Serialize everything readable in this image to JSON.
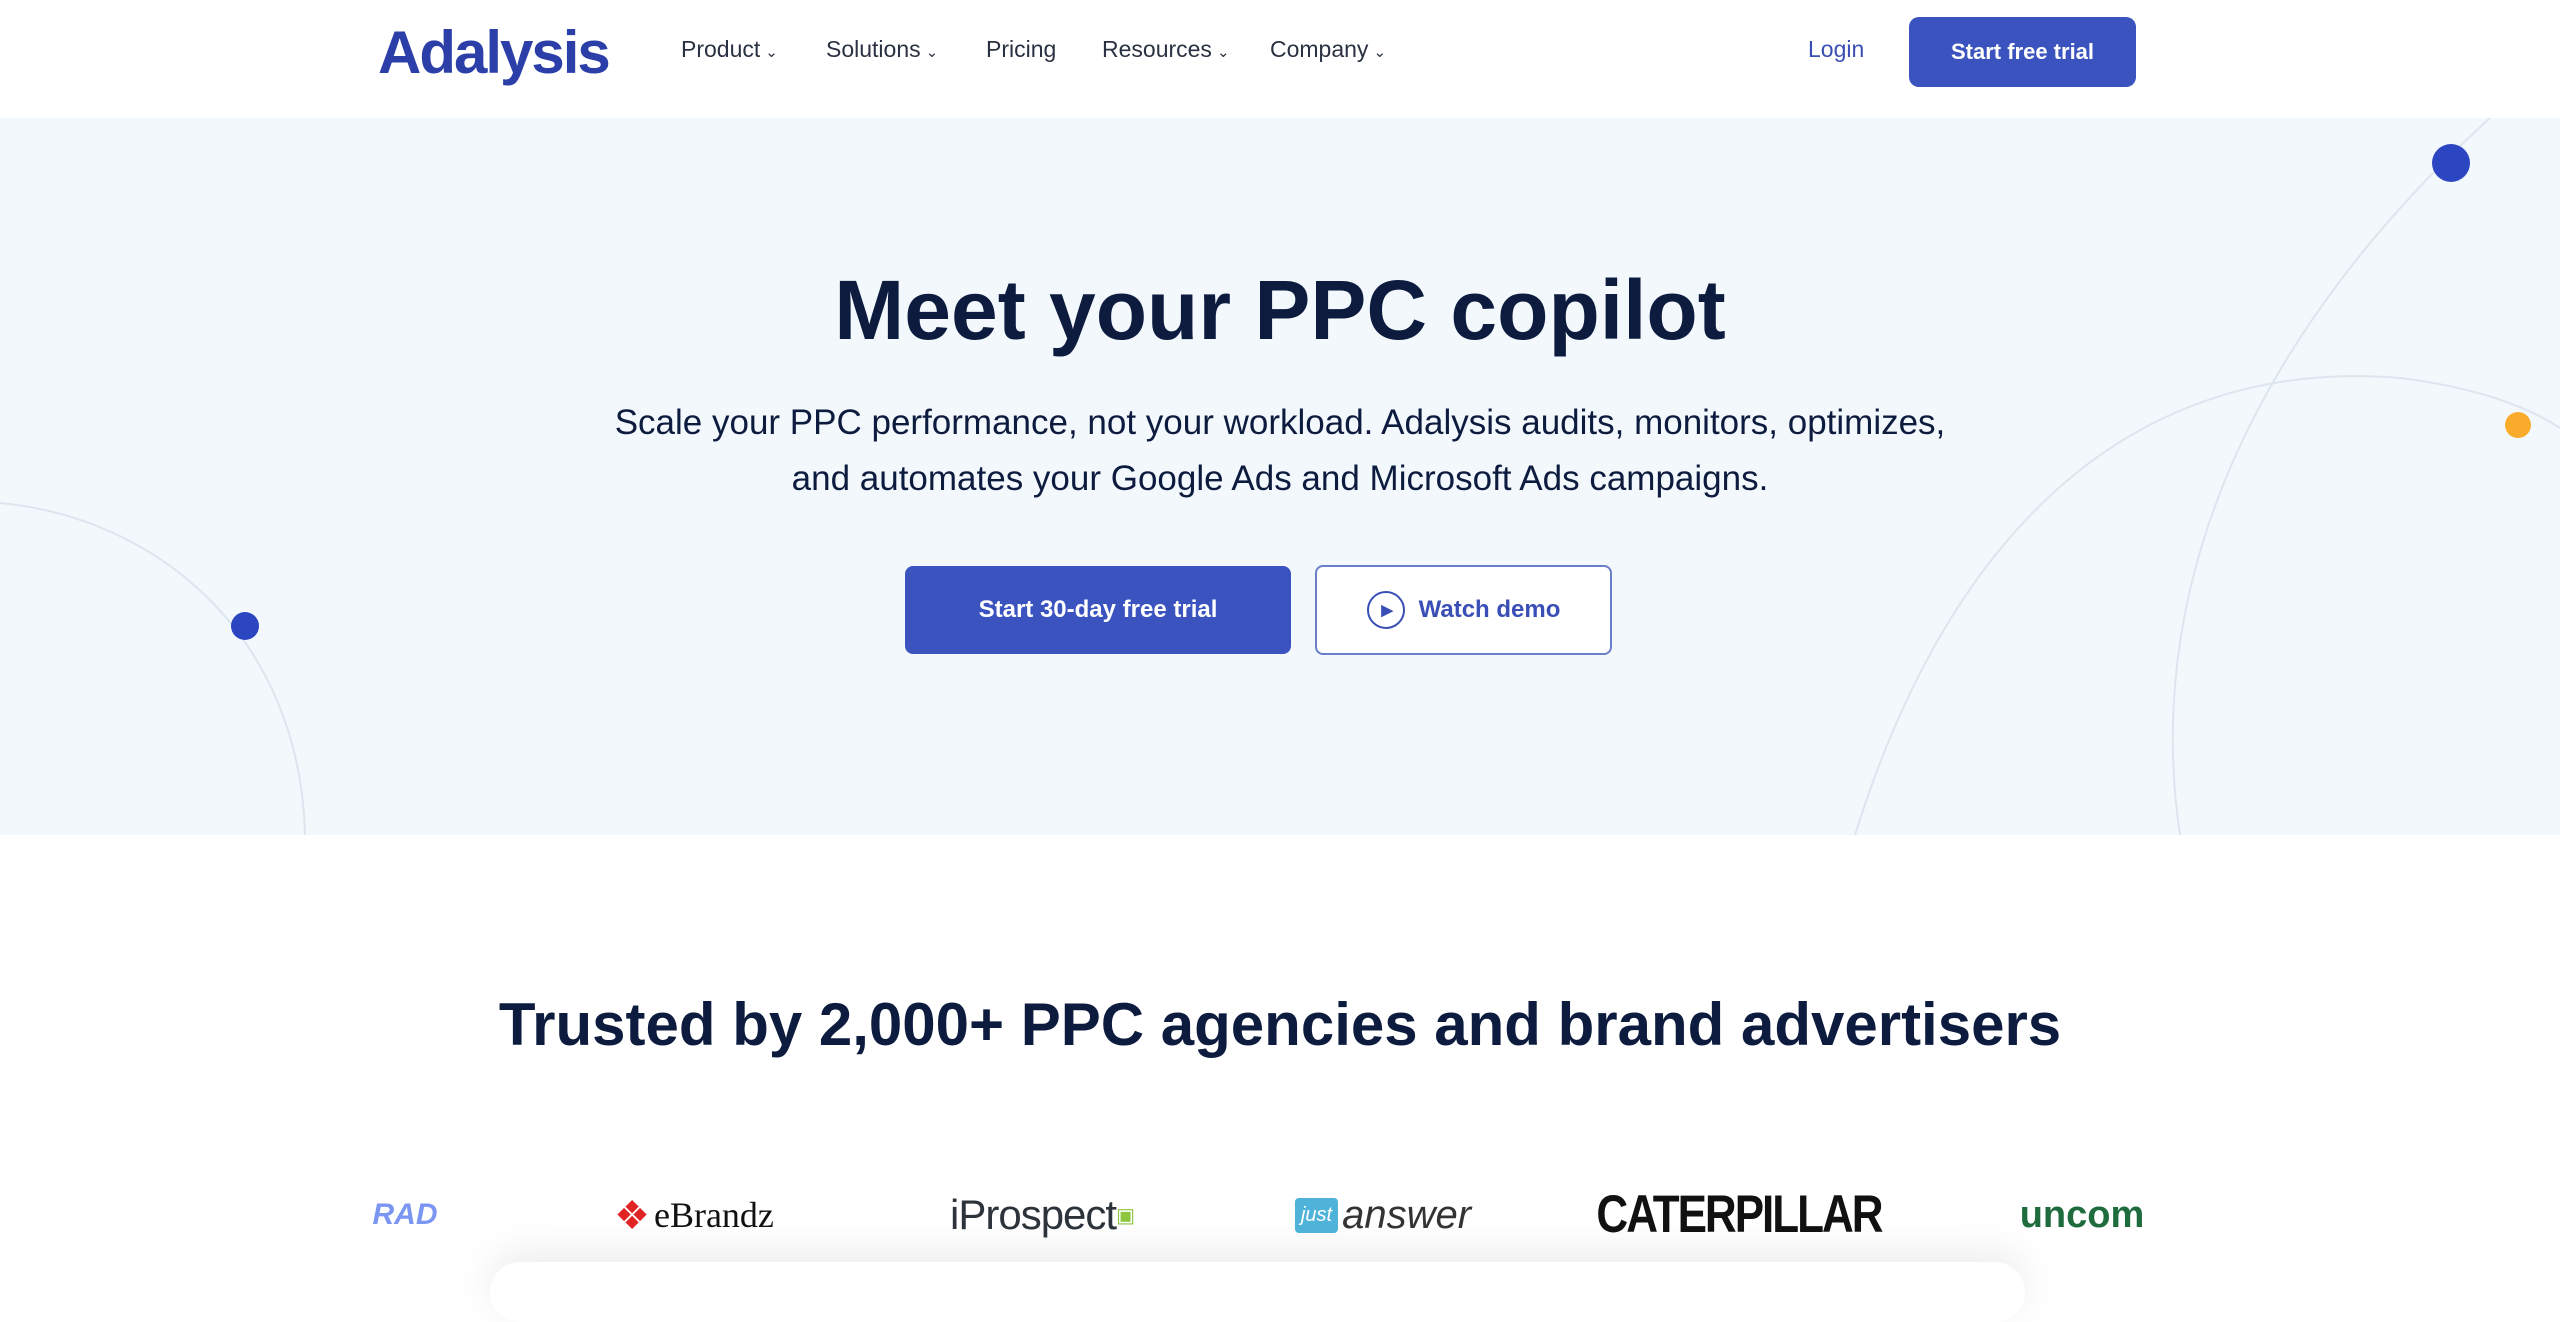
{
  "nav": {
    "logo": "Adalysis",
    "items": [
      {
        "label": "Product",
        "dropdown": true
      },
      {
        "label": "Solutions",
        "dropdown": true
      },
      {
        "label": "Pricing",
        "dropdown": false
      },
      {
        "label": "Resources",
        "dropdown": true
      },
      {
        "label": "Company",
        "dropdown": true
      }
    ],
    "login": "Login",
    "cta": "Start free trial"
  },
  "hero": {
    "title": "Meet your PPC copilot",
    "subtitle_line1": "Scale your PPC performance, not your workload. Adalysis audits, monitors, optimizes,",
    "subtitle_line2": "and automates your Google Ads and Microsoft Ads campaigns.",
    "primary_button": "Start 30-day free trial",
    "secondary_button": "Watch demo",
    "secondary_icon": "play-icon"
  },
  "trusted": {
    "heading": "Trusted by 2,000+ PPC agencies and brand advertisers",
    "logos": [
      "RAD",
      "eBrandz",
      "iProspect",
      "just answer",
      "CATERPILLAR",
      "uncom"
    ]
  },
  "colors": {
    "accent": "#3a53bf",
    "hero_bg": "#f3f8fd",
    "dot_blue": "#2c46c2",
    "dot_orange": "#f9ac2b",
    "heading": "#0d1b3e"
  }
}
